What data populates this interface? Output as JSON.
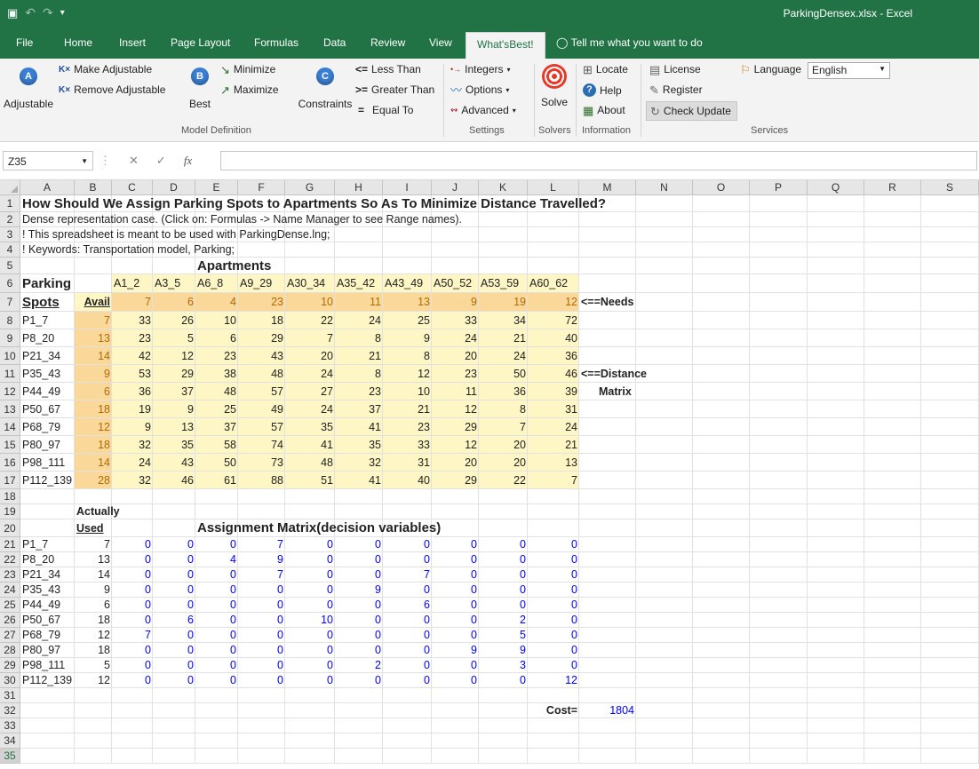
{
  "app": {
    "title": "ParkingDensex.xlsx  -  Excel"
  },
  "qat": {
    "save": "💾",
    "undo": "↶",
    "redo": "↷",
    "customize": "▾"
  },
  "tabs": [
    "File",
    "Home",
    "Insert",
    "Page Layout",
    "Formulas",
    "Data",
    "Review",
    "View",
    "What'sBest!"
  ],
  "tell_me": "Tell me what you want to do",
  "ribbon": {
    "adjustable": "Adjustable",
    "make_adjustable": "Make Adjustable",
    "remove_adjustable": "Remove Adjustable",
    "best": "Best",
    "minimize": "Minimize",
    "maximize": "Maximize",
    "constraints": "Constraints",
    "less_than": "Less Than",
    "greater_than": "Greater Than",
    "equal_to": "Equal To",
    "integers": "Integers",
    "options": "Options",
    "advanced": "Advanced",
    "solve": "Solve",
    "locate": "Locate",
    "help": "Help",
    "about": "About",
    "license": "License",
    "register": "Register",
    "check_update": "Check Update",
    "language_label": "Language",
    "language_value": "English",
    "group_model": "Model Definition",
    "group_settings": "Settings",
    "group_solvers": "Solvers",
    "group_information": "Information",
    "group_services": "Services",
    "sym_lt": "<=",
    "sym_gt": ">=",
    "sym_eq": "="
  },
  "formula_bar": {
    "name_box": "Z35",
    "cancel": "✕",
    "enter": "✓",
    "fx": "fx",
    "formula": ""
  },
  "columns": [
    "A",
    "B",
    "C",
    "D",
    "E",
    "F",
    "G",
    "H",
    "I",
    "J",
    "K",
    "L",
    "M",
    "N",
    "O",
    "P",
    "Q",
    "R",
    "S"
  ],
  "rows": [
    "1",
    "2",
    "3",
    "4",
    "5",
    "6",
    "7",
    "8",
    "9",
    "10",
    "11",
    "12",
    "13",
    "14",
    "15",
    "16",
    "17",
    "18",
    "19",
    "20",
    "21",
    "22",
    "23",
    "24",
    "25",
    "26",
    "27",
    "28",
    "29",
    "30",
    "31",
    "32",
    "33",
    "34",
    "35"
  ],
  "sheet": {
    "title": "How Should We Assign Parking Spots to Apartments So As To Minimize Distance Travelled?",
    "line2": "  Dense representation case. (Click on: Formulas -> Name Manager to see Range names).",
    "line3": "! This spreadsheet is meant to be used with ParkingDense.lng;",
    "line4": "! Keywords: Transportation model, Parking;",
    "apartments": "Apartments",
    "parking": "Parking",
    "spots": "Spots",
    "avail": "Avail",
    "apt_names": [
      "A1_2",
      "A3_5",
      "A6_8",
      "A9_29",
      "A30_34",
      "A35_42",
      "A43_49",
      "A50_52",
      "A53_59",
      "A60_62"
    ],
    "needs": [
      "7",
      "6",
      "4",
      "23",
      "10",
      "11",
      "13",
      "9",
      "19",
      "12"
    ],
    "needs_label": "<==Needs",
    "spot_names": [
      "P1_7",
      "P8_20",
      "P21_34",
      "P35_43",
      "P44_49",
      "P50_67",
      "P68_79",
      "P80_97",
      "P98_111",
      "P112_139"
    ],
    "avail_vals": [
      "7",
      "13",
      "14",
      "9",
      "6",
      "18",
      "12",
      "18",
      "14",
      "28"
    ],
    "distance": [
      [
        "33",
        "26",
        "10",
        "18",
        "22",
        "24",
        "25",
        "33",
        "34",
        "72"
      ],
      [
        "23",
        "5",
        "6",
        "29",
        "7",
        "8",
        "9",
        "24",
        "21",
        "40"
      ],
      [
        "42",
        "12",
        "23",
        "43",
        "20",
        "21",
        "8",
        "20",
        "24",
        "36"
      ],
      [
        "53",
        "29",
        "38",
        "48",
        "24",
        "8",
        "12",
        "23",
        "50",
        "46"
      ],
      [
        "36",
        "37",
        "48",
        "57",
        "27",
        "23",
        "10",
        "11",
        "36",
        "39"
      ],
      [
        "19",
        "9",
        "25",
        "49",
        "24",
        "37",
        "21",
        "12",
        "8",
        "31"
      ],
      [
        "9",
        "13",
        "37",
        "57",
        "35",
        "41",
        "23",
        "29",
        "7",
        "24"
      ],
      [
        "32",
        "35",
        "58",
        "74",
        "41",
        "35",
        "33",
        "12",
        "20",
        "21"
      ],
      [
        "24",
        "43",
        "50",
        "73",
        "48",
        "32",
        "31",
        "20",
        "20",
        "13"
      ],
      [
        "32",
        "46",
        "61",
        "88",
        "51",
        "41",
        "40",
        "29",
        "22",
        "7"
      ]
    ],
    "distance_label": "<==Distance",
    "matrix_label": "Matrix",
    "actually": "Actually",
    "used": "Used",
    "assignment_title": "Assignment Matrix(decision variables)",
    "used_vals": [
      "7",
      "13",
      "14",
      "9",
      "6",
      "18",
      "12",
      "18",
      "5",
      "12"
    ],
    "assignment": [
      [
        "0",
        "0",
        "0",
        "7",
        "0",
        "0",
        "0",
        "0",
        "0",
        "0"
      ],
      [
        "0",
        "0",
        "4",
        "9",
        "0",
        "0",
        "0",
        "0",
        "0",
        "0"
      ],
      [
        "0",
        "0",
        "0",
        "7",
        "0",
        "0",
        "7",
        "0",
        "0",
        "0"
      ],
      [
        "0",
        "0",
        "0",
        "0",
        "0",
        "9",
        "0",
        "0",
        "0",
        "0"
      ],
      [
        "0",
        "0",
        "0",
        "0",
        "0",
        "0",
        "6",
        "0",
        "0",
        "0"
      ],
      [
        "0",
        "6",
        "0",
        "0",
        "10",
        "0",
        "0",
        "0",
        "2",
        "0"
      ],
      [
        "7",
        "0",
        "0",
        "0",
        "0",
        "0",
        "0",
        "0",
        "5",
        "0"
      ],
      [
        "0",
        "0",
        "0",
        "0",
        "0",
        "0",
        "0",
        "9",
        "9",
        "0"
      ],
      [
        "0",
        "0",
        "0",
        "0",
        "0",
        "2",
        "0",
        "0",
        "3",
        "0"
      ],
      [
        "0",
        "0",
        "0",
        "0",
        "0",
        "0",
        "0",
        "0",
        "0",
        "12"
      ]
    ],
    "cost_label": "Cost=",
    "cost_value": "1804"
  },
  "colors": {
    "excel_green": "#217346",
    "needs_fill": "#fad89a",
    "matrix_fill": "#fff6c5",
    "decision_blue": "#0000ff"
  }
}
